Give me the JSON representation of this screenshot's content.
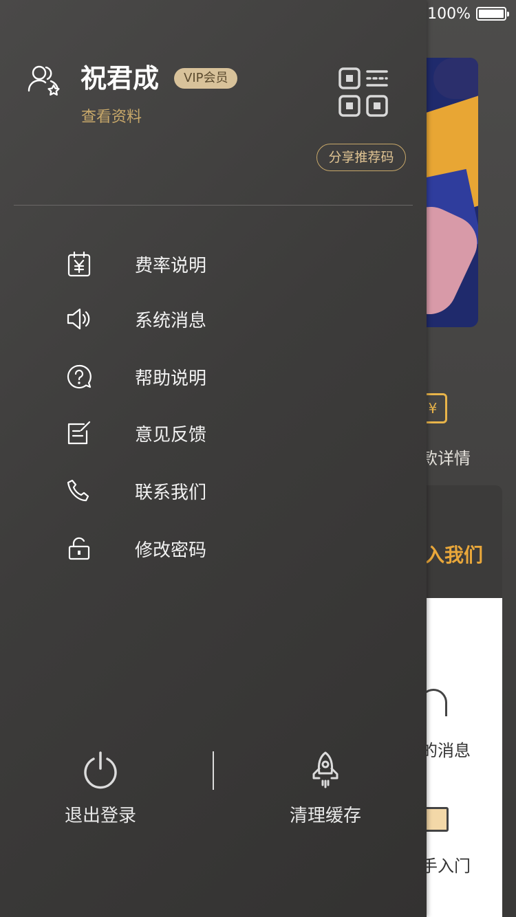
{
  "status_bar": {
    "battery_text": "100%"
  },
  "background_app": {
    "icon_label_partial": "款详情",
    "join_partial": "入我们",
    "message_partial": "的消息",
    "guide_partial": "手入门"
  },
  "drawer": {
    "user": {
      "name": "祝君成",
      "badge": "VIP会员",
      "view_profile": "查看资料"
    },
    "share_button": "分享推荐码",
    "menu": [
      {
        "label": "费率说明",
        "icon": "yen-calendar-icon"
      },
      {
        "label": "系统消息",
        "icon": "speaker-icon"
      },
      {
        "label": "帮助说明",
        "icon": "help-icon"
      },
      {
        "label": "意见反馈",
        "icon": "feedback-edit-icon"
      },
      {
        "label": "联系我们",
        "icon": "phone-icon"
      },
      {
        "label": "修改密码",
        "icon": "unlock-icon"
      }
    ],
    "bottom": {
      "logout": "退出登录",
      "clear_cache": "清理缓存"
    }
  },
  "colors": {
    "gold": "#c9a96a",
    "accent_orange": "#e9a73a",
    "drawer_bg": "#3f3e3d"
  }
}
